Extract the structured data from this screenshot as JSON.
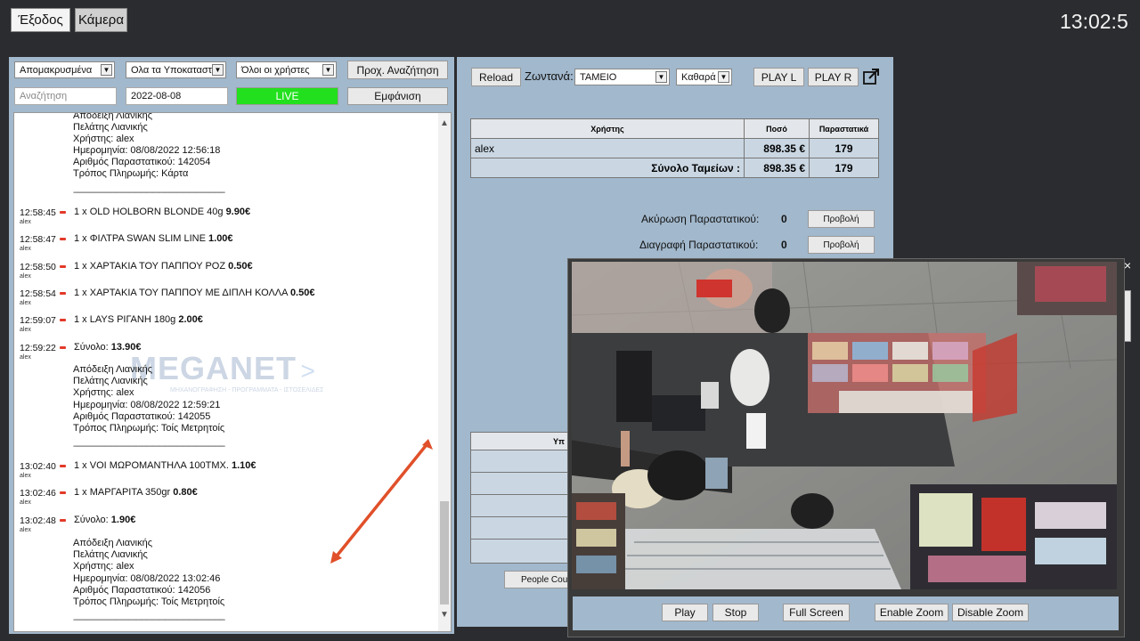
{
  "top": {
    "exit_label": "Έξοδος",
    "camera_label": "Κάμερα",
    "clock": "13:02:5"
  },
  "filters": {
    "status_select": "Απομακρυσμένα",
    "branch_select": "Ολα τα Υποκαταστή",
    "users_select": "Όλοι οι χρήστες",
    "advanced_search": "Προχ. Αναζήτηση",
    "search_placeholder": "Αναζήτηση",
    "date_value": "2022-08-08",
    "live_label": "LIVE",
    "show_label": "Εμφάνιση"
  },
  "log": {
    "receipt1": {
      "l1": "Απόδειξη Λιανικής",
      "l2": "Πελάτης Λιανικής",
      "l3": "Χρήστης: alex",
      "l4": "Ημερομηνία: 08/08/2022 12:56:18",
      "l5": "Αριθμός Παραστατικού: 142054",
      "l6": "Τρόπος Πληρωμής: Κάρτα"
    },
    "sep": "-------------------------------------------------------------------------",
    "entries1": [
      {
        "time": "12:58:45",
        "user": "alex",
        "text": "1 x OLD HOLBORN BLONDE 40g ",
        "price": "9.90€"
      },
      {
        "time": "12:58:47",
        "user": "alex",
        "text": "1 x ΦΙΛΤΡΑ SWAN SLIM LINE ",
        "price": "1.00€"
      },
      {
        "time": "12:58:50",
        "user": "alex",
        "text": "1 x ΧΑΡΤΑΚΙΑ ΤΟΥ ΠΑΠΠΟΥ ΡΟΖ ",
        "price": "0.50€"
      },
      {
        "time": "12:58:54",
        "user": "alex",
        "text": "1 x ΧΑΡΤΑΚΙΑ ΤΟΥ ΠΑΠΠΟΥ ΜΕ ΔΙΠΛΗ ΚΟΛΛΑ ",
        "price": "0.50€"
      },
      {
        "time": "12:59:07",
        "user": "alex",
        "text": "1 x LAYS ΡΙΓΑΝΗ 180g ",
        "price": "2.00€"
      },
      {
        "time": "12:59:22",
        "user": "alex",
        "text": "Σύνολο: ",
        "price": "13.90€"
      }
    ],
    "receipt2": {
      "l1": "Απόδειξη Λιανικής",
      "l2": "Πελάτης Λιανικής",
      "l3": "Χρήστης: alex",
      "l4": "Ημερομηνία: 08/08/2022 12:59:21",
      "l5": "Αριθμός Παραστατικού: 142055",
      "l6": "Τρόπος Πληρωμής: Τοίς Μετρητοίς"
    },
    "entries2": [
      {
        "time": "13:02:40",
        "user": "alex",
        "text": "1 x VOI ΜΩΡΟΜΑΝΤΗΛΑ 100ΤΜΧ. ",
        "price": "1.10€"
      },
      {
        "time": "13:02:46",
        "user": "alex",
        "text": "1 x ΜΑΡΓΑΡΙΤΑ 350gr ",
        "price": "0.80€"
      },
      {
        "time": "13:02:48",
        "user": "alex",
        "text": "Σύνολο: ",
        "price": "1.90€"
      }
    ],
    "receipt3": {
      "l1": "Απόδειξη Λιανικής",
      "l2": "Πελάτης Λιανικής",
      "l3": "Χρήστης: alex",
      "l4": "Ημερομηνία: 08/08/2022 13:02:46",
      "l5": "Αριθμός Παραστατικού: 142056",
      "l6": "Τρόπος Πληρωμής: Τοίς Μετρητοίς"
    },
    "watermark": "MEGANET",
    "watermark_sub": "ΜΗΧΑΝΟΓΡΑΦΗΣΗ - ΠΡΟΓΡΑΜΜΑΤΑ - ΙΣΤΟΣΕΛΙΔΕΣ"
  },
  "right": {
    "reload": "Reload",
    "live_label": "Ζωντανά:",
    "register_select": "ΤΑΜΕΙΟ",
    "clean_select": "Καθαρά",
    "play_l": "PLAY L",
    "play_r": "PLAY R",
    "table": {
      "headers": [
        "Χρήστης",
        "Ποσό",
        "Παραστατικά"
      ],
      "row": {
        "user": "alex",
        "amount": "898.35 €",
        "docs": "179"
      },
      "total": {
        "label": "Σύνολο Ταμείων :",
        "amount": "898.35 €",
        "docs": "179"
      }
    },
    "cancel_label": "Ακύρωση Παραστατικού:",
    "cancel_count": "0",
    "delete_label": "Διαγραφή Παραστατικού:",
    "delete_count": "0",
    "view_label": "Προβολή",
    "partial_header": "Υπ",
    "people_counter": "People Cou"
  },
  "video": {
    "close": "×",
    "play": "Play",
    "stop": "Stop",
    "fullscreen": "Full Screen",
    "enable_zoom": "Enable Zoom",
    "disable_zoom": "Disable Zoom"
  },
  "colors": {
    "live_green": "#22e01e",
    "panel_blue": "#a2b8cc",
    "arrow_red": "#e0502a"
  }
}
